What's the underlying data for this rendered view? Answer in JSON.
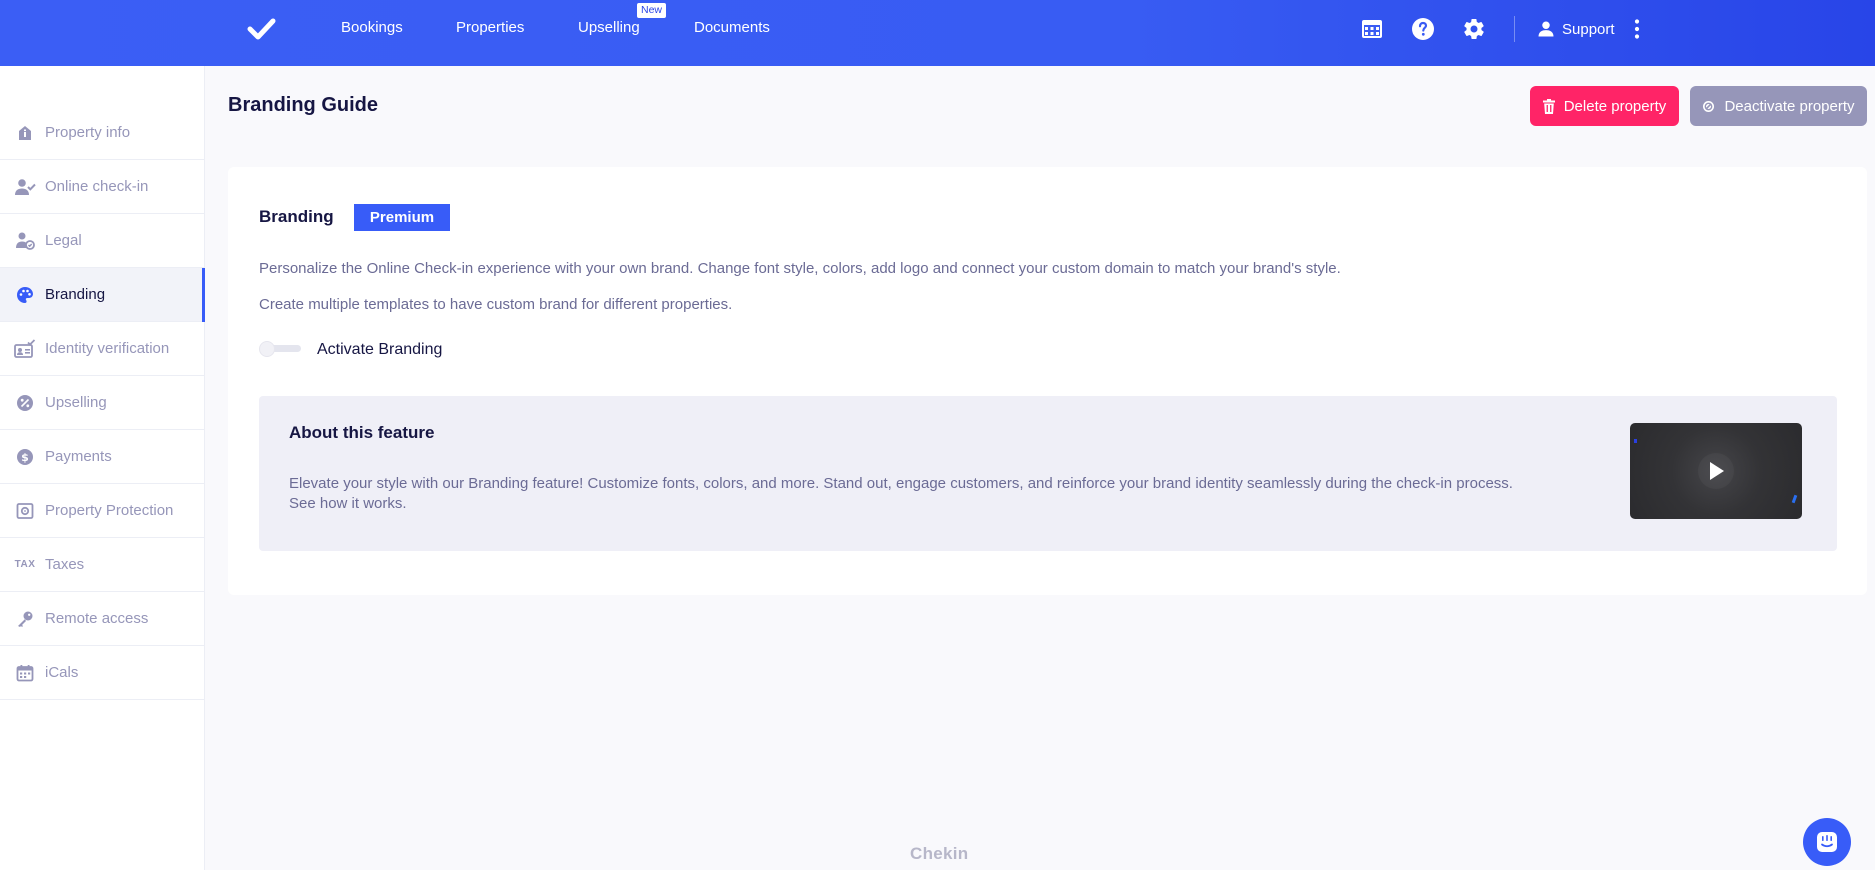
{
  "nav": {
    "items": [
      {
        "label": "Bookings"
      },
      {
        "label": "Properties"
      },
      {
        "label": "Upselling"
      },
      {
        "label": "Documents"
      }
    ],
    "new_badge": "New",
    "support_label": "Support",
    "icons": [
      "logo-check-icon",
      "table-icon",
      "help-icon",
      "gear-icon",
      "user-icon",
      "kebab-menu-icon"
    ]
  },
  "sidebar": {
    "items": [
      {
        "label": "Property info",
        "icon": "info-icon"
      },
      {
        "label": "Online check-in",
        "icon": "user-check-icon"
      },
      {
        "label": "Legal",
        "icon": "legal-icon"
      },
      {
        "label": "Branding",
        "icon": "palette-icon",
        "active": true
      },
      {
        "label": "Identity verification",
        "icon": "id-card-icon"
      },
      {
        "label": "Upselling",
        "icon": "discount-icon"
      },
      {
        "label": "Payments",
        "icon": "dollar-icon"
      },
      {
        "label": "Property Protection",
        "icon": "safe-icon"
      },
      {
        "label": "Taxes",
        "icon": "tax-icon",
        "icon_text": "TAX"
      },
      {
        "label": "Remote access",
        "icon": "key-icon"
      },
      {
        "label": "iCals",
        "icon": "calendar-icon"
      }
    ]
  },
  "header": {
    "title": "Branding Guide",
    "delete_label": "Delete property",
    "deactivate_label": "Deactivate property"
  },
  "branding": {
    "title": "Branding",
    "badge": "Premium",
    "description1": "Personalize the Online Check-in experience with your own brand. Change font style, colors, add logo and connect your custom domain to match your brand's style.",
    "description2": "Create multiple templates to have custom brand for different properties.",
    "toggle_label": "Activate Branding",
    "toggle_on": false
  },
  "about": {
    "title": "About this feature",
    "text_line1": "Elevate your style with our Branding feature! Customize fonts, colors, and more. Stand out, engage customers, and reinforce your brand identity seamlessly during the check-in process.",
    "text_line2": "See how it works."
  },
  "footer": {
    "brand": "Chekin"
  },
  "colors": {
    "primary": "#385cf8",
    "danger": "#ff2467",
    "muted": "#9696b9",
    "text": "#161643",
    "body_text": "#6b6b95",
    "background": "#f9f9fc"
  }
}
